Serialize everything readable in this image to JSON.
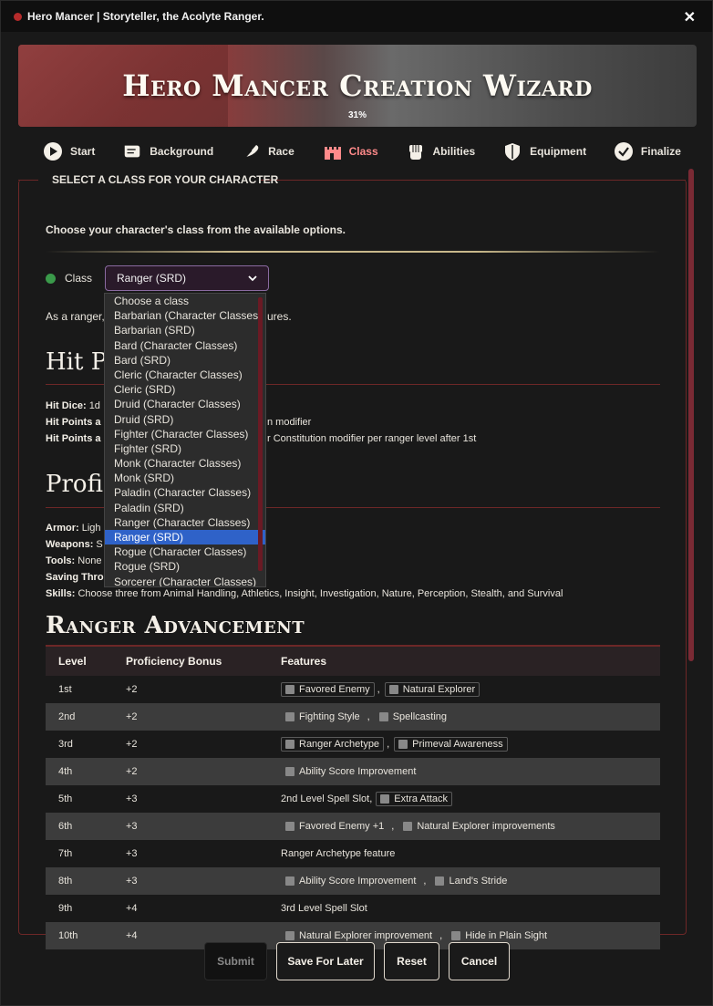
{
  "window": {
    "title": "Hero Mancer | Storyteller, the Acolyte Ranger."
  },
  "header": {
    "title": "Hero Mancer Creation Wizard",
    "progress": "31%"
  },
  "steps": [
    {
      "label": "Start",
      "icon": "play-icon"
    },
    {
      "label": "Background",
      "icon": "scroll-icon"
    },
    {
      "label": "Race",
      "icon": "feather-icon"
    },
    {
      "label": "Class",
      "icon": "castle-icon"
    },
    {
      "label": "Abilities",
      "icon": "fist-icon"
    },
    {
      "label": "Equipment",
      "icon": "shield-icon"
    },
    {
      "label": "Finalize",
      "icon": "check-circle-icon"
    }
  ],
  "section": {
    "legend": "SELECT A CLASS FOR YOUR CHARACTER",
    "intro": "Choose your character's class from the available options.",
    "class_label": "Class",
    "class_value": "Ranger (SRD)",
    "desc_start": "As a ranger,",
    "desc_end": "ures."
  },
  "dropdown": {
    "options": [
      "Choose a class",
      "Barbarian (Character Classes)",
      "Barbarian (SRD)",
      "Bard (Character Classes)",
      "Bard (SRD)",
      "Cleric (Character Classes)",
      "Cleric (SRD)",
      "Druid (Character Classes)",
      "Druid (SRD)",
      "Fighter (Character Classes)",
      "Fighter (SRD)",
      "Monk (Character Classes)",
      "Monk (SRD)",
      "Paladin (Character Classes)",
      "Paladin (SRD)",
      "Ranger (Character Classes)",
      "Ranger (SRD)",
      "Rogue (Character Classes)",
      "Rogue (SRD)",
      "Sorcerer (Character Classes)"
    ],
    "selected": "Ranger (SRD)"
  },
  "hitpoints": {
    "heading": "Hit Po",
    "hit_dice_label": "Hit Dice:",
    "hit_dice_value": "1d",
    "hp1_label": "Hit Points a",
    "hp1_value": "n modifier",
    "hp2_label": "Hit Points a",
    "hp2_value": "r Constitution modifier per ranger level after 1st"
  },
  "proficiencies": {
    "heading": "Profic",
    "armor_label": "Armor:",
    "armor_value": "Ligh",
    "weapons_label": "Weapons:",
    "weapons_value": "S",
    "tools_label": "Tools:",
    "tools_value": "None",
    "saving_label": "Saving Thro",
    "skills_label": "Skills:",
    "skills_value": "Choose three from Animal Handling, Athletics, Insight, Investigation, Nature, Perception, Stealth, and Survival"
  },
  "advancement": {
    "title": "Ranger Advancement",
    "headers": [
      "Level",
      "Proficiency Bonus",
      "Features"
    ],
    "rows": [
      {
        "level": "1st",
        "bonus": "+2",
        "prefix": "",
        "features": [
          "Favored Enemy",
          "Natural Explorer"
        ],
        "boxed": true
      },
      {
        "level": "2nd",
        "bonus": "+2",
        "prefix": "",
        "features": [
          "Fighting Style",
          "Spellcasting"
        ],
        "boxed": false
      },
      {
        "level": "3rd",
        "bonus": "+2",
        "prefix": "",
        "features": [
          "Ranger Archetype",
          "Primeval Awareness"
        ],
        "boxed": true
      },
      {
        "level": "4th",
        "bonus": "+2",
        "prefix": "",
        "features": [
          "Ability Score Improvement"
        ],
        "boxed": false
      },
      {
        "level": "5th",
        "bonus": "+3",
        "prefix": "2nd Level Spell Slot,",
        "features": [
          "Extra Attack"
        ],
        "boxed": true
      },
      {
        "level": "6th",
        "bonus": "+3",
        "prefix": "",
        "features": [
          "Favored Enemy +1",
          "Natural Explorer improvements"
        ],
        "boxed": false
      },
      {
        "level": "7th",
        "bonus": "+3",
        "prefix": "Ranger Archetype feature",
        "features": [],
        "boxed": false
      },
      {
        "level": "8th",
        "bonus": "+3",
        "prefix": "",
        "features": [
          "Ability Score Improvement",
          "Land's Stride"
        ],
        "boxed": false
      },
      {
        "level": "9th",
        "bonus": "+4",
        "prefix": "3rd Level Spell Slot",
        "features": [],
        "boxed": false
      },
      {
        "level": "10th",
        "bonus": "+4",
        "prefix": "",
        "features": [
          "Natural Explorer improvement",
          "Hide in Plain Sight"
        ],
        "boxed": false
      }
    ]
  },
  "footer": {
    "submit": "Submit",
    "save": "Save For Later",
    "reset": "Reset",
    "cancel": "Cancel"
  },
  "colors": {
    "accent": "#6d2727",
    "selected": "#2f62c8",
    "active_step": "#ff8a8a"
  }
}
